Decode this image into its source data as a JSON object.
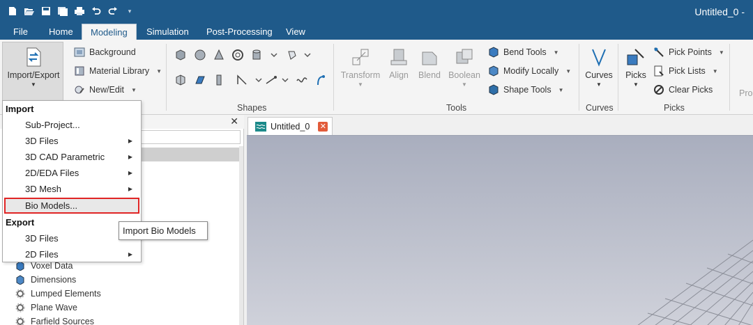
{
  "window": {
    "title": "Untitled_0 - "
  },
  "quick_access": {
    "icons": [
      "new-icon",
      "open-icon",
      "save-icon",
      "save-all-icon",
      "print-icon",
      "undo-icon",
      "redo-icon",
      "customize-icon"
    ]
  },
  "menu_tabs": [
    "File",
    "Home",
    "Modeling",
    "Simulation",
    "Post-Processing",
    "View"
  ],
  "active_tab": "Modeling",
  "ribbon": {
    "import_export": "Import/Export",
    "background": "Background",
    "material_library": "Material Library",
    "new_edit": "New/Edit",
    "shapes_label": "Shapes",
    "transform": "Transform",
    "align": "Align",
    "blend": "Blend",
    "boolean": "Boolean",
    "bend_tools": "Bend Tools",
    "modify_locally": "Modify Locally",
    "shape_tools": "Shape Tools",
    "tools_label": "Tools",
    "curves": "Curves",
    "curves_label": "Curves",
    "picks": "Picks",
    "pick_points": "Pick Points",
    "pick_lists": "Pick Lists",
    "clear_picks": "Clear Picks",
    "picks_label": "Picks",
    "pro_partial": "Pro"
  },
  "left_panel": {
    "tree_items": [
      "Voxel Data",
      "Dimensions",
      "Lumped Elements",
      "Plane Wave",
      "Farfield Sources"
    ]
  },
  "document_tab": {
    "label": "Untitled_0"
  },
  "dropdown": {
    "import_header": "Import",
    "import_items": [
      {
        "label": "Sub-Project...",
        "submenu": false
      },
      {
        "label": "3D Files",
        "submenu": true
      },
      {
        "label": "3D CAD Parametric",
        "submenu": true
      },
      {
        "label": "2D/EDA Files",
        "submenu": true
      },
      {
        "label": "3D Mesh",
        "submenu": true
      },
      {
        "label": "Bio Models...",
        "submenu": false
      }
    ],
    "export_header": "Export",
    "export_items": [
      {
        "label": "3D Files",
        "submenu": false
      },
      {
        "label": "2D Files",
        "submenu": true
      }
    ],
    "highlighted_item": "Bio Models..."
  },
  "tooltip": {
    "text": "Import Bio Models"
  },
  "colors": {
    "titlebar": "#1f5a8a",
    "highlight_outline": "#e02424",
    "close_tab": "#e25b3a"
  }
}
